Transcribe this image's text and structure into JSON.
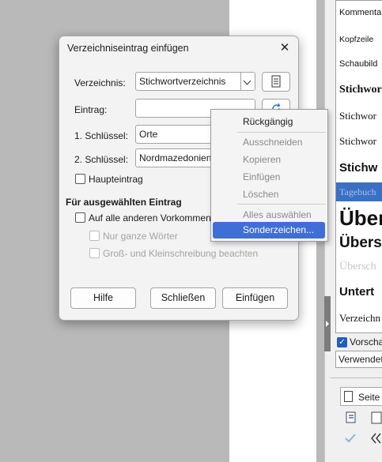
{
  "dialog": {
    "title": "Verzeichniseintrag einfügen",
    "close": "✕",
    "verzeichnis_label": "Verzeichnis:",
    "verzeichnis_value": "Stichwortverzeichnis",
    "eintrag_label": "Eintrag:",
    "eintrag_value": "",
    "key1_label": "1. Schlüssel:",
    "key1_value": "Orte",
    "key2_label": "2. Schlüssel:",
    "key2_value": "Nordmazedonien",
    "haupteintrag": "Haupteintrag",
    "section_title": "Für ausgewählten Eintrag",
    "alle_vorkommen": "Auf alle anderen Vorkommen",
    "ganze_woerter": "Nur ganze Wörter",
    "gross_klein": "Groß- und Kleinschreibung beachten",
    "buttons": {
      "help": "Hilfe",
      "close": "Schließen",
      "insert": "Einfügen"
    }
  },
  "context_menu": {
    "undo": "Rückgängig",
    "cut": "Ausschneiden",
    "copy": "Kopieren",
    "paste": "Einfügen",
    "delete": "Löschen",
    "select_all": "Alles auswählen",
    "special_chars": "Sonderzeichen..."
  },
  "sidebar": {
    "styles": [
      "Kommentar",
      "Kopfzeile",
      "Schaubild",
      "Stichwor",
      "Stichwor",
      "Stichwor",
      "Stichw",
      "Tagebuch",
      "Über",
      "Übers",
      "Übersch",
      "Untert",
      "Verzeichn"
    ],
    "preview_label": "Vorscha",
    "combo_value": "Verwendet",
    "page_button": "Seite"
  },
  "colors": {
    "accent": "#3f6fd6",
    "selection": "#3b6fc4"
  }
}
